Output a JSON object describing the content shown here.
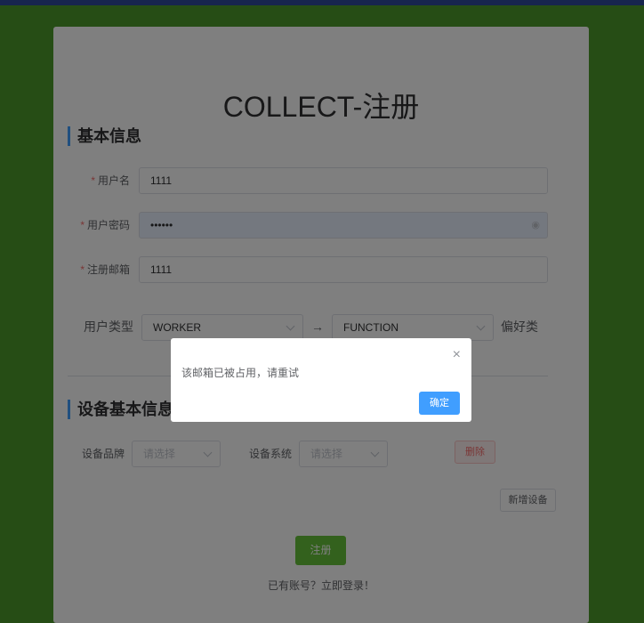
{
  "title": "COLLECT-注册",
  "basic": {
    "heading": "基本信息",
    "username": {
      "label": "用户名",
      "value": "1111"
    },
    "password": {
      "label": "用户密码",
      "value": "••••••"
    },
    "email": {
      "label": "注册邮箱",
      "value": "1111"
    },
    "user_type_label": "用户类型",
    "user_type_value": "WORKER",
    "arrow": "→",
    "preference_value": "FUNCTION",
    "preference_label": "偏好类"
  },
  "device": {
    "heading": "设备基本信息",
    "brand_label": "设备品牌",
    "brand_placeholder": "请选择",
    "system_label": "设备系统",
    "system_placeholder": "请选择",
    "delete_label": "删除",
    "add_label": "新增设备"
  },
  "register_label": "注册",
  "login_link": "已有账号？立即登录！",
  "dialog": {
    "message": "该邮箱已被占用，请重试",
    "ok_label": "确定",
    "close": "×"
  },
  "colors": {
    "primary": "#409eff",
    "success": "#67c23a",
    "danger": "#f56c6c",
    "background": "#4d9a2a"
  }
}
